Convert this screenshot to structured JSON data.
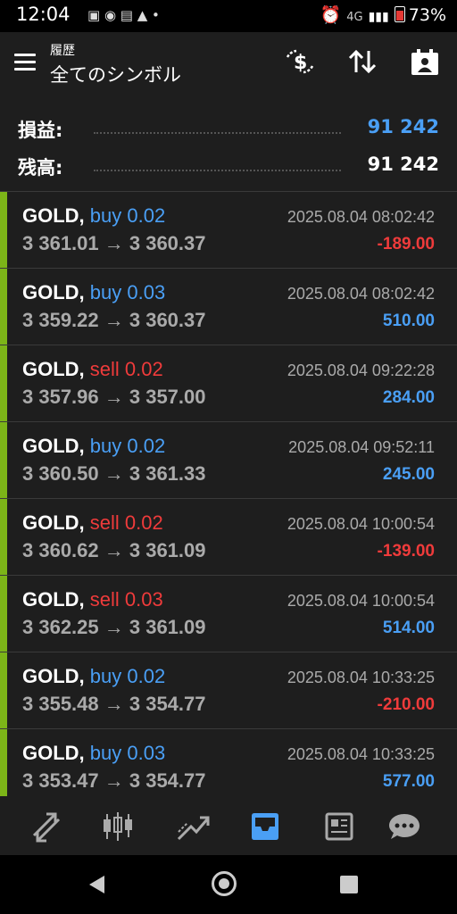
{
  "status": {
    "time": "12:04",
    "signal": "4G",
    "battery": "73%"
  },
  "header": {
    "subtitle": "履歴",
    "title": "全てのシンボル"
  },
  "summary": {
    "profit_label": "損益:",
    "profit_value": "91 242",
    "balance_label": "残高:",
    "balance_value": "91 242",
    "colors": {
      "profit": "#4a9ff5",
      "balance": "#ffffff"
    }
  },
  "trades": [
    {
      "symbol": "GOLD,",
      "side": "buy 0.02",
      "prices": "3 361.01 → 3 360.37",
      "datetime": "2025.08.04 08:02:42",
      "profit": "-189.00"
    },
    {
      "symbol": "GOLD,",
      "side": "buy 0.03",
      "prices": "3 359.22 → 3 360.37",
      "datetime": "2025.08.04 08:02:42",
      "profit": "510.00"
    },
    {
      "symbol": "GOLD,",
      "side": "sell 0.02",
      "prices": "3 357.96 → 3 357.00",
      "datetime": "2025.08.04 09:22:28",
      "profit": "284.00"
    },
    {
      "symbol": "GOLD,",
      "side": "buy 0.02",
      "prices": "3 360.50 → 3 361.33",
      "datetime": "2025.08.04 09:52:11",
      "profit": "245.00"
    },
    {
      "symbol": "GOLD,",
      "side": "sell 0.02",
      "prices": "3 360.62 → 3 361.09",
      "datetime": "2025.08.04 10:00:54",
      "profit": "-139.00"
    },
    {
      "symbol": "GOLD,",
      "side": "sell 0.03",
      "prices": "3 362.25 → 3 361.09",
      "datetime": "2025.08.04 10:00:54",
      "profit": "514.00"
    },
    {
      "symbol": "GOLD,",
      "side": "buy 0.02",
      "prices": "3 355.48 → 3 354.77",
      "datetime": "2025.08.04 10:33:25",
      "profit": "-210.00"
    },
    {
      "symbol": "GOLD,",
      "side": "buy 0.03",
      "prices": "3 353.47 → 3 354.77",
      "datetime": "2025.08.04 10:33:25",
      "profit": "577.00"
    }
  ],
  "tabs": [
    {
      "icon": "quotes-icon",
      "active": false
    },
    {
      "icon": "chart-icon",
      "active": false
    },
    {
      "icon": "trade-icon",
      "active": false
    },
    {
      "icon": "history-icon",
      "active": true
    },
    {
      "icon": "news-icon",
      "active": false
    },
    {
      "icon": "chat-icon",
      "active": false
    }
  ],
  "colors": {
    "accent": "#4a9ff5",
    "buy": "#4a9ff5",
    "sell": "#ef3b3b",
    "loss": "#ef3b3b",
    "position_bar": "#7cb518"
  }
}
